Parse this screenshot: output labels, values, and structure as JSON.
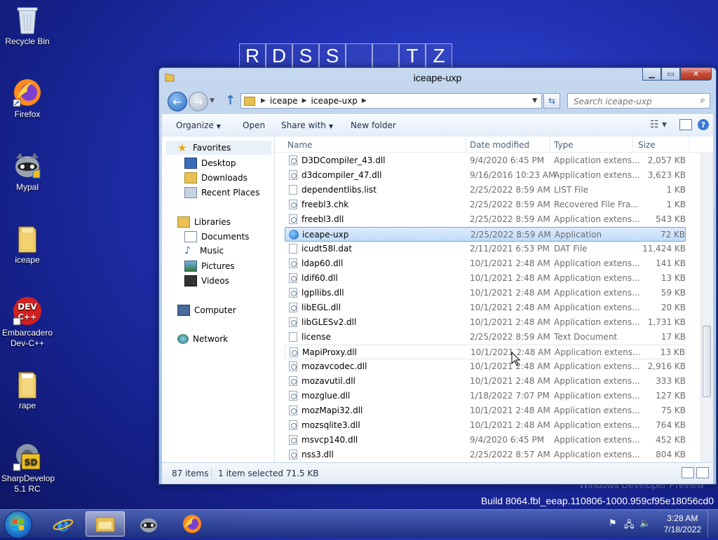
{
  "background": {
    "tiles": [
      "R",
      "D",
      "S",
      "S",
      "",
      "",
      "T",
      "Z"
    ],
    "watermark_line1": "Windows Developer Preview",
    "watermark_line2": "Build 8064.fbl_eeap.110806-1000.959cf95e18056cd0"
  },
  "desktop": [
    {
      "label_line1": "Recycle Bin",
      "label_line2": "",
      "icon": "recycle-bin-icon"
    },
    {
      "label_line1": "Firefox",
      "label_line2": "",
      "icon": "firefox-icon"
    },
    {
      "label_line1": "Mypal",
      "label_line2": "",
      "icon": "mypal-icon"
    },
    {
      "label_line1": "iceape",
      "label_line2": "",
      "icon": "folder-icon"
    },
    {
      "label_line1": "Embarcadero",
      "label_line2": "Dev-C++",
      "icon": "devcpp-icon"
    },
    {
      "label_line1": "rape",
      "label_line2": "",
      "icon": "folder-icon"
    },
    {
      "label_line1": "SharpDevelop",
      "label_line2": "5.1 RC",
      "icon": "sharpdevelop-icon"
    }
  ],
  "window": {
    "title": "iceape-uxp",
    "breadcrumb": [
      "iceape",
      "iceape-uxp"
    ],
    "search_placeholder": "Search iceape-uxp",
    "toolbar": {
      "organize": "Organize",
      "open": "Open",
      "share_with": "Share with",
      "new_folder": "New folder"
    },
    "nav": {
      "favorites": "Favorites",
      "desktop": "Desktop",
      "downloads": "Downloads",
      "recent": "Recent Places",
      "libraries": "Libraries",
      "documents": "Documents",
      "music": "Music",
      "pictures": "Pictures",
      "videos": "Videos",
      "computer": "Computer",
      "network": "Network"
    },
    "columns": {
      "name": "Name",
      "date": "Date modified",
      "type": "Type",
      "size": "Size"
    },
    "files": [
      {
        "name": "D3DCompiler_43.dll",
        "date": "9/4/2020 6:45 PM",
        "type": "Application extens...",
        "size": "2,057 KB",
        "kind": "dll"
      },
      {
        "name": "d3dcompiler_47.dll",
        "date": "9/16/2016 10:23 AM",
        "type": "Application extens...",
        "size": "3,623 KB",
        "kind": "dll"
      },
      {
        "name": "dependentlibs.list",
        "date": "2/25/2022 8:59 AM",
        "type": "LIST File",
        "size": "1 KB",
        "kind": "file"
      },
      {
        "name": "freebl3.chk",
        "date": "2/25/2022 8:59 AM",
        "type": "Recovered File Fra...",
        "size": "1 KB",
        "kind": "dll"
      },
      {
        "name": "freebl3.dll",
        "date": "2/25/2022 8:59 AM",
        "type": "Application extens...",
        "size": "543 KB",
        "kind": "dll"
      },
      {
        "name": "iceape-uxp",
        "date": "2/25/2022 8:59 AM",
        "type": "Application",
        "size": "72 KB",
        "kind": "app"
      },
      {
        "name": "icudt58l.dat",
        "date": "2/11/2021 6:53 PM",
        "type": "DAT File",
        "size": "11,424 KB",
        "kind": "file"
      },
      {
        "name": "ldap60.dll",
        "date": "10/1/2021 2:48 AM",
        "type": "Application extens...",
        "size": "141 KB",
        "kind": "dll"
      },
      {
        "name": "ldif60.dll",
        "date": "10/1/2021 2:48 AM",
        "type": "Application extens...",
        "size": "13 KB",
        "kind": "dll"
      },
      {
        "name": "lgpllibs.dll",
        "date": "10/1/2021 2:48 AM",
        "type": "Application extens...",
        "size": "59 KB",
        "kind": "dll"
      },
      {
        "name": "libEGL.dll",
        "date": "10/1/2021 2:48 AM",
        "type": "Application extens...",
        "size": "20 KB",
        "kind": "dll"
      },
      {
        "name": "libGLESv2.dll",
        "date": "10/1/2021 2:48 AM",
        "type": "Application extens...",
        "size": "1,731 KB",
        "kind": "dll"
      },
      {
        "name": "license",
        "date": "2/25/2022 8:59 AM",
        "type": "Text Document",
        "size": "17 KB",
        "kind": "file"
      },
      {
        "name": "MapiProxy.dll",
        "date": "10/1/2021 2:48 AM",
        "type": "Application extens...",
        "size": "13 KB",
        "kind": "dll"
      },
      {
        "name": "mozavcodec.dll",
        "date": "10/1/2021 2:48 AM",
        "type": "Application extens...",
        "size": "2,916 KB",
        "kind": "dll"
      },
      {
        "name": "mozavutil.dll",
        "date": "10/1/2021 2:48 AM",
        "type": "Application extens...",
        "size": "333 KB",
        "kind": "dll"
      },
      {
        "name": "mozglue.dll",
        "date": "1/18/2022 7:07 PM",
        "type": "Application extens...",
        "size": "127 KB",
        "kind": "dll"
      },
      {
        "name": "mozMapi32.dll",
        "date": "10/1/2021 2:48 AM",
        "type": "Application extens...",
        "size": "75 KB",
        "kind": "dll"
      },
      {
        "name": "mozsqlite3.dll",
        "date": "10/1/2021 2:48 AM",
        "type": "Application extens...",
        "size": "764 KB",
        "kind": "dll"
      },
      {
        "name": "msvcp140.dll",
        "date": "9/4/2020 6:45 PM",
        "type": "Application extens...",
        "size": "452 KB",
        "kind": "dll"
      },
      {
        "name": "nss3.dll",
        "date": "2/25/2022 8:57 AM",
        "type": "Application extens...",
        "size": "804 KB",
        "kind": "dll"
      }
    ],
    "selected_index": 5,
    "hover_index": 13,
    "status": {
      "items": "87 items",
      "selected": "1 item selected 71.5 KB"
    }
  },
  "taskbar": {
    "apps": [
      "internet-explorer-icon",
      "file-explorer-icon",
      "mypal-icon",
      "firefox-icon"
    ],
    "time": "3:28 AM",
    "date": "7/18/2022"
  },
  "colors": {
    "accent": "#2a6cc4",
    "selection": "#c1dcfc",
    "desktop_bg": "#2233b8"
  }
}
